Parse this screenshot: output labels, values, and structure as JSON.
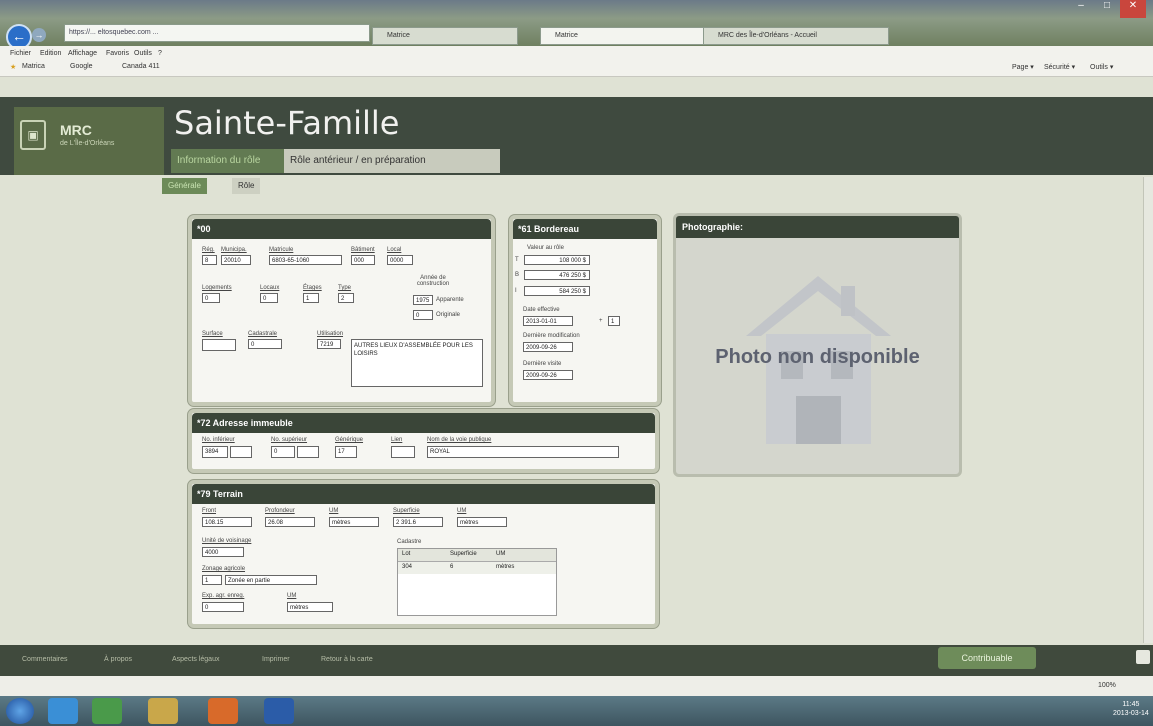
{
  "browser": {
    "address": "https://... eltosquebec.com ...",
    "tabs": [
      {
        "label": "Matrice"
      },
      {
        "label": "Matrice"
      },
      {
        "label": "MRC des Île-d'Orléans - Accueil"
      }
    ],
    "window_controls": [
      "–",
      "□",
      "✕"
    ],
    "menu": [
      "Fichier",
      "Edition",
      "Affichage",
      "Favoris",
      "Outils",
      "?"
    ],
    "favorites": [
      "Matrica",
      "Google",
      "Canada 411"
    ],
    "commands": [
      "Page ▾",
      "Sécurité ▾",
      "Outils ▾"
    ]
  },
  "app": {
    "logo_mrc": "MRC",
    "logo_sub": "de L'Île-d'Orléans",
    "title": "Sainte-Famille",
    "tabs": [
      "Information du rôle",
      "Rôle antérieur / en préparation"
    ],
    "subtabs": [
      "Générale",
      "Rôle"
    ]
  },
  "panel00": {
    "title": "*00",
    "labels": {
      "reg": "Rég.",
      "municipalite": "Municipa.",
      "matricule": "Matricule",
      "batiment": "Bâtiment",
      "local": "Local",
      "logements": "Logements",
      "locaux": "Locaux",
      "etages": "Étages",
      "type": "Type",
      "annee_construction": "Année de construction",
      "apparente": "Apparente",
      "originale": "Originale",
      "sous_sol": "Surface",
      "cadre": "Cadastrale",
      "utilisation": "Utilisation"
    },
    "values": {
      "reg": "8",
      "municipalite": "20010",
      "matricule": "6803-65-1060",
      "batiment": "000",
      "local": "0000",
      "logements": "0",
      "locaux": "0",
      "etages": "1",
      "type": "2",
      "annee_apparente": "1975",
      "annee_originale": "0",
      "sous_sol": "",
      "cadre": "0",
      "utilisation_code": "7219",
      "utilisation_desc": "AUTRES LIEUX D'ASSEMBLÉE POUR LES LOISIRS"
    }
  },
  "panel61": {
    "title": "*61 Bordereau",
    "labels": {
      "valeur_role": "Valeur au rôle",
      "t": "T",
      "b": "B",
      "i": "I",
      "date_effective": "Date effective",
      "plus": "+",
      "derniere_modif": "Dernière modification",
      "derniere_visite": "Dernière visite"
    },
    "values": {
      "terrain": "108 000 $",
      "batiment": "476 250 $",
      "immeuble": "584 250 $",
      "date_effective": "2013-01-01",
      "plus": "1",
      "derniere_modif": "2009-09-26",
      "derniere_visite": "2009-09-26"
    }
  },
  "panel72": {
    "title": "*72 Adresse immeuble",
    "labels": {
      "no_inferieur": "No. inférieur",
      "no_superieur": "No. supérieur",
      "generique": "Générique",
      "lien": "Lien",
      "voie": "Nom de la voie publique"
    },
    "values": {
      "no_inferieur": "3894",
      "no_superieur": "0",
      "no_sup2": "",
      "generique": "17",
      "lien": "",
      "voie": "ROYAL"
    }
  },
  "panel79": {
    "title": "*79 Terrain",
    "labels": {
      "front": "Front",
      "profondeur": "Profondeur",
      "um1": "UM",
      "superficie": "Superficie",
      "um2": "UM",
      "unite_voisinage": "Unité de voisinage",
      "zonage": "Zonage agricole",
      "cadastre": "Cadastre",
      "exp_agr": "Exp. agr. enreg.",
      "um3": "UM"
    },
    "values": {
      "front": "108.15",
      "profondeur": "26.08",
      "um1": "mètres",
      "superficie": "2 391.6",
      "um2": "mètres",
      "unite_voisinage": "4000",
      "zonage_code": "1",
      "zonage_desc": "Zonée en partie",
      "exp_agr": "0",
      "um3": "mètres"
    },
    "cadastre_table": {
      "headers": [
        "Lot",
        "Superficie",
        "UM"
      ],
      "rows": [
        [
          "304",
          "6",
          "mètres"
        ]
      ]
    }
  },
  "photo": {
    "title": "Photographie:",
    "placeholder": "Photo non disponible"
  },
  "footer": {
    "links": [
      "Commentaires",
      "À propos",
      "Aspects légaux",
      "Imprimer",
      "Retour à la carte"
    ],
    "contrib_button": "Contribuable"
  },
  "status": {
    "zoom": "100%"
  },
  "clock": {
    "time": "11:45",
    "date": "2013-03-14"
  }
}
